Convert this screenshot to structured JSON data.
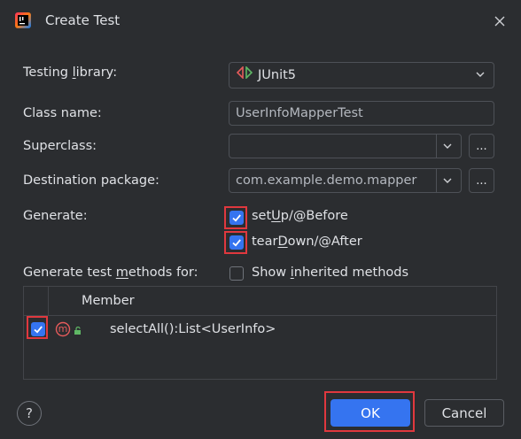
{
  "dialog": {
    "title": "Create Test"
  },
  "fields": {
    "testing_library": {
      "label_pre": "Testing ",
      "label_mn": "l",
      "label_post": "ibrary:",
      "value": "JUnit5"
    },
    "class_name": {
      "label": "Class name:",
      "value": "UserInfoMapperTest"
    },
    "superclass": {
      "label": "Superclass:",
      "value": ""
    },
    "destination_package": {
      "label": "Destination package:",
      "value": "com.example.demo.mapper"
    },
    "browse_label": "..."
  },
  "generate": {
    "label": "Generate:",
    "setup": {
      "pre": "set",
      "mn": "U",
      "post": "p/@Before",
      "checked": true
    },
    "teardown": {
      "pre": "tear",
      "mn": "D",
      "post": "own/@After",
      "checked": true
    }
  },
  "methods": {
    "label_pre": "Generate test ",
    "label_mn": "m",
    "label_post": "ethods for:",
    "show_inherited": {
      "pre": "Show ",
      "mn": "i",
      "post": "nherited methods",
      "checked": false
    },
    "column_header": "Member",
    "rows": [
      {
        "member": "selectAll():List<UserInfo>",
        "checked": true,
        "icon_letter": "m"
      }
    ]
  },
  "buttons": {
    "help": "?",
    "ok": "OK",
    "cancel": "Cancel"
  },
  "colors": {
    "accent": "#3574f0",
    "highlight": "#e0383e",
    "background": "#2b2d30"
  }
}
